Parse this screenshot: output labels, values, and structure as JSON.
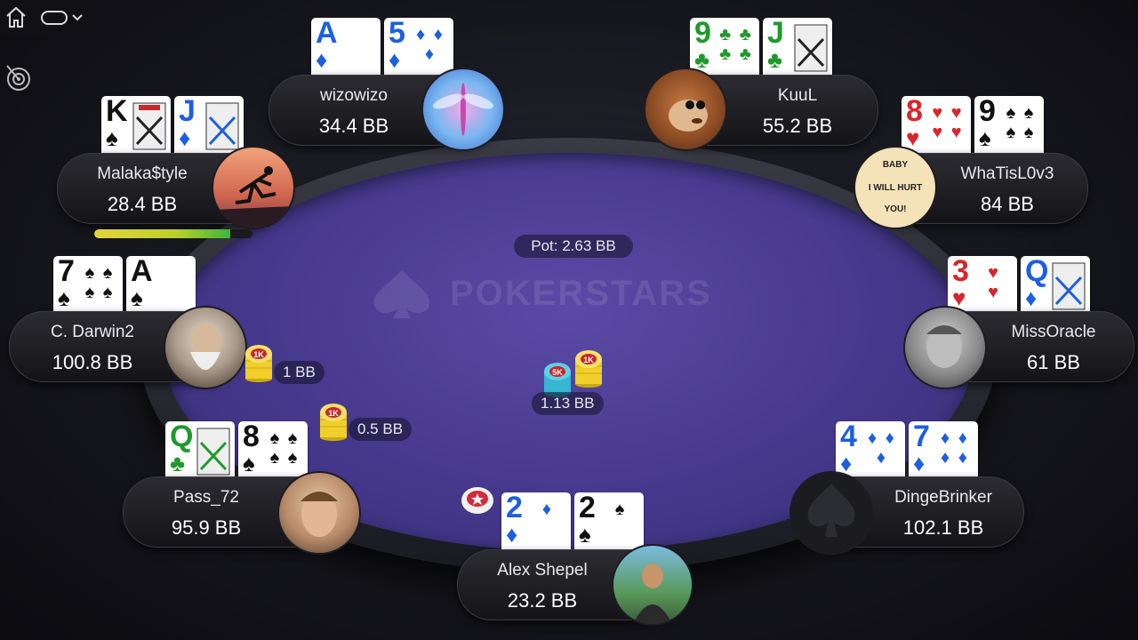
{
  "pot": {
    "label": "Pot: 2.63 BB"
  },
  "brand": {
    "watermark": "POKERSTARS"
  },
  "center_bet": {
    "amount": "1.13 BB",
    "chips": [
      "5K",
      "1K"
    ]
  },
  "colors": {
    "felt": "#46388c",
    "timer_start": "#e6d23a",
    "timer_end": "#3fb53a",
    "diamonds": "#1c5fe0",
    "clubs": "#1f9a2b",
    "hearts": "#d8262a"
  },
  "timer": {
    "fraction_remaining": 0.86
  },
  "players": {
    "wizowizo": {
      "name": "wizowizo",
      "stack": "34.4 BB",
      "cards": [
        {
          "rank": "A",
          "suit": "diamonds"
        },
        {
          "rank": "5",
          "suit": "diamonds"
        }
      ]
    },
    "kuul": {
      "name": "KuuL",
      "stack": "55.2 BB",
      "cards": [
        {
          "rank": "9",
          "suit": "clubs"
        },
        {
          "rank": "J",
          "suit": "clubs"
        }
      ]
    },
    "malaka": {
      "name": "Malaka$tyle",
      "stack": "28.4 BB",
      "cards": [
        {
          "rank": "K",
          "suit": "spades"
        },
        {
          "rank": "J",
          "suit": "diamonds"
        }
      ]
    },
    "whatislov3": {
      "name": "WhaTisL0v3",
      "stack": "84 BB",
      "cards": [
        {
          "rank": "8",
          "suit": "hearts"
        },
        {
          "rank": "9",
          "suit": "spades"
        }
      ],
      "avatar_text": [
        "BABY",
        "I WILL HURT",
        "YOU!"
      ]
    },
    "darwin": {
      "name": "C. Darwin2",
      "stack": "100.8 BB",
      "cards": [
        {
          "rank": "7",
          "suit": "spades"
        },
        {
          "rank": "A",
          "suit": "spades"
        }
      ],
      "bet": "1 BB",
      "bet_chip": "1K"
    },
    "missoracle": {
      "name": "MissOracle",
      "stack": "61 BB",
      "cards": [
        {
          "rank": "3",
          "suit": "hearts"
        },
        {
          "rank": "Q",
          "suit": "diamonds"
        }
      ]
    },
    "pass72": {
      "name": "Pass_72",
      "stack": "95.9 BB",
      "cards": [
        {
          "rank": "Q",
          "suit": "clubs"
        },
        {
          "rank": "8",
          "suit": "spades"
        }
      ],
      "bet": "0.5 BB",
      "bet_chip": "1K"
    },
    "dinge": {
      "name": "DingeBrinker",
      "stack": "102.1 BB",
      "cards": [
        {
          "rank": "4",
          "suit": "diamonds"
        },
        {
          "rank": "7",
          "suit": "diamonds"
        }
      ]
    },
    "alex": {
      "name": "Alex Shepel",
      "stack": "23.2 BB",
      "cards": [
        {
          "rank": "2",
          "suit": "diamonds"
        },
        {
          "rank": "2",
          "suit": "spades"
        }
      ]
    }
  },
  "icons": {
    "home": "home-icon",
    "toggle": "toggle-icon",
    "target": "target-icon",
    "dealer": "dealer-button-icon"
  }
}
